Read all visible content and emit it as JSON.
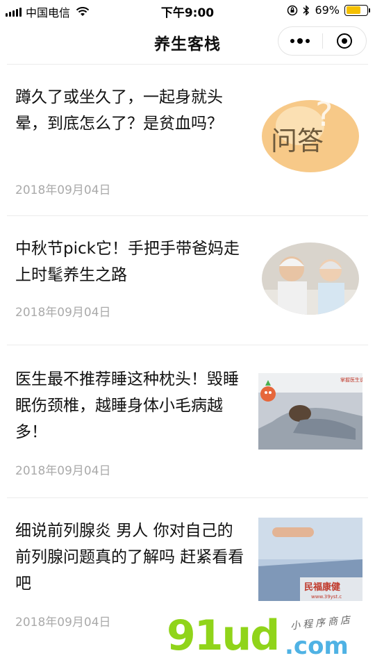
{
  "status_bar": {
    "carrier": "中国电信",
    "time": "下午9:00",
    "battery_percent": "69%",
    "battery_level": 0.69,
    "icons": [
      "signal-icon",
      "wifi-icon",
      "orientation-lock-icon",
      "bluetooth-icon",
      "battery-icon"
    ]
  },
  "nav": {
    "title": "养生客栈",
    "more_icon": "more-dots-icon",
    "close_icon": "miniprogram-close-icon"
  },
  "articles": [
    {
      "title": "蹲久了或坐久了，一起身就头晕，到底怎么了？是贫血吗？",
      "date": "2018年09月04日",
      "thumb_label": "问答"
    },
    {
      "title": "中秋节pick它！手把手带爸妈走上时髦养生之路",
      "date": "2018年09月04日"
    },
    {
      "title": "医生最不推荐睡这种枕头！毁睡眠伤颈椎，越睡身体小毛病越多！",
      "date": "2018年09月04日",
      "thumb_label": "掌握医生说"
    },
    {
      "title": "细说前列腺炎 男人 你对自己的前列腺问题真的了解吗 赶紧看看吧",
      "date": "2018年09月04日",
      "thumb_label": "民福康健",
      "thumb_url": "www.39yst.c"
    }
  ],
  "watermark": {
    "brand": "91ud",
    "domain": ".com",
    "tagline": "小程序商店"
  },
  "colors": {
    "accent_battery": "#f5c000",
    "date_gray": "#aaaaaa",
    "divider": "#ececec",
    "watermark_green": "#90d41a",
    "watermark_blue": "#4fb2e4"
  }
}
